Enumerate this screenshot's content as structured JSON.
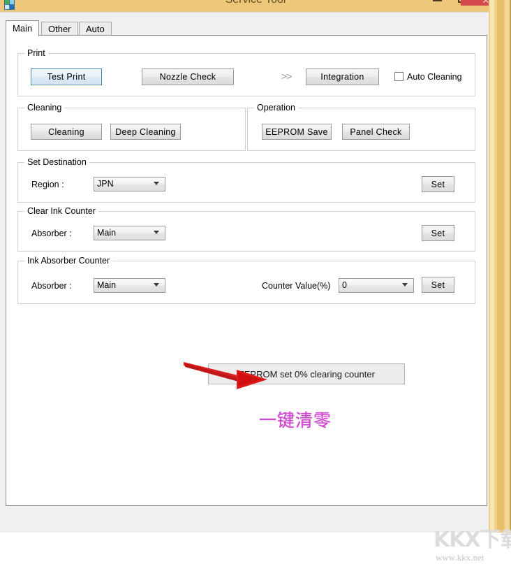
{
  "window": {
    "title": "Service Tool",
    "icon": "app-icon",
    "controls": {
      "minimize": "minimize-button",
      "maximize": "maximize-button",
      "close_label": "✕"
    }
  },
  "tabs": [
    {
      "label": "Main",
      "active": true
    },
    {
      "label": "Other",
      "active": false
    },
    {
      "label": "Auto",
      "active": false
    }
  ],
  "groups": {
    "print": {
      "legend": "Print",
      "test_print": "Test Print",
      "nozzle_check": "Nozzle Check",
      "chevron": ">>",
      "integration": "Integration",
      "auto_cleaning": "Auto Cleaning",
      "auto_cleaning_checked": false
    },
    "cleaning": {
      "legend": "Cleaning",
      "cleaning": "Cleaning",
      "deep_cleaning": "Deep Cleaning"
    },
    "operation": {
      "legend": "Operation",
      "eeprom_save": "EEPROM Save",
      "panel_check": "Panel Check"
    },
    "set_destination": {
      "legend": "Set Destination",
      "region_label": "Region :",
      "region_value": "JPN",
      "set": "Set"
    },
    "clear_ink_counter": {
      "legend": "Clear Ink Counter",
      "absorber_label": "Absorber :",
      "absorber_value": "Main",
      "set": "Set"
    },
    "ink_absorber_counter": {
      "legend": "Ink Absorber Counter",
      "absorber_label": "Absorber :",
      "absorber_value": "Main",
      "counter_value_label": "Counter Value(%)",
      "counter_value": "0",
      "set": "Set"
    }
  },
  "annotations": {
    "wide_button": "EEPROM set 0% clearing counter",
    "chinese_note": "一键清零",
    "arrow_color": "#d91f1f",
    "note_color": "#d04ad0"
  },
  "watermark": {
    "logo": "KKX下载",
    "url": "www.kkx.net"
  },
  "colors": {
    "title_bar": "#eec87a",
    "close_button": "#d14a4a",
    "focus_border": "#3c7fb1"
  }
}
